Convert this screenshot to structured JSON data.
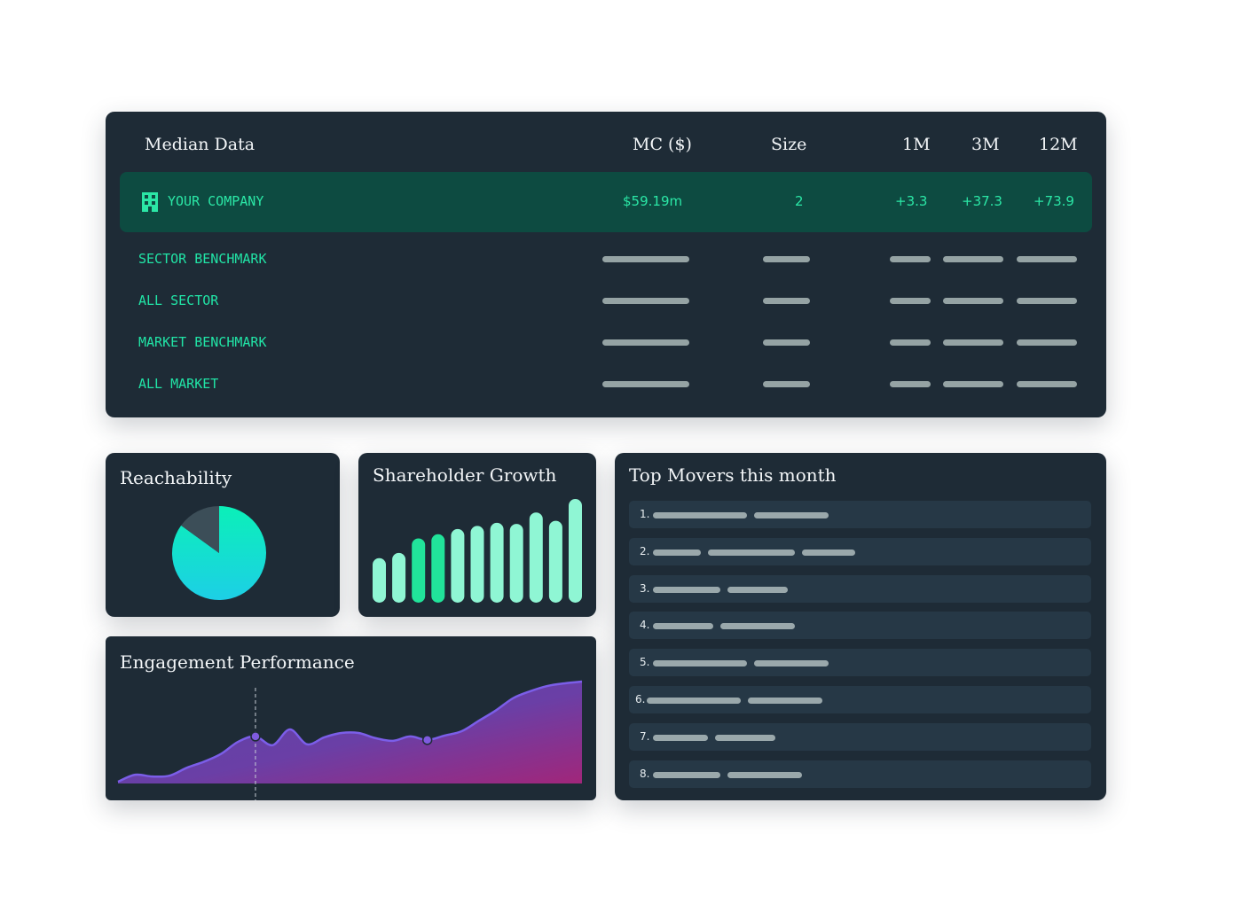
{
  "median": {
    "title": "Median Data",
    "columns": [
      "MC ($)",
      "Size",
      "1M",
      "3M",
      "12M"
    ],
    "company": {
      "icon": "building-icon",
      "name": "YOUR COMPANY",
      "mc": "$59.19m",
      "size": "2",
      "m1": "+3.3",
      "m3": "+37.3",
      "m12": "+73.9"
    },
    "rows": [
      "SECTOR BENCHMARK",
      "ALL SECTOR",
      "MARKET BENCHMARK",
      "ALL MARKET"
    ]
  },
  "reachability": {
    "title": "Reachability",
    "chart_data": {
      "type": "pie",
      "slices": [
        {
          "label": "",
          "value": 85,
          "color": "#19d9d6"
        },
        {
          "label": "",
          "value": 15,
          "color": "#3c4e58"
        }
      ]
    }
  },
  "shareholder": {
    "title": "Shareholder Growth",
    "chart_data": {
      "type": "bar",
      "values": [
        43,
        48,
        62,
        66,
        71,
        74,
        77,
        76,
        87,
        79,
        100
      ],
      "colors": [
        "#8ff6d4",
        "#8ff6d4",
        "#21e39a",
        "#21e39a",
        "#8ff6d4",
        "#8ff6d4",
        "#8ff6d4",
        "#8ff6d4",
        "#8ff6d4",
        "#8ff6d4",
        "#8ff6d4"
      ]
    }
  },
  "engagement": {
    "title": "Engagement Performance",
    "chart_data": {
      "type": "area",
      "values": [
        2,
        10,
        8,
        9,
        18,
        25,
        34,
        48,
        54,
        44,
        62,
        45,
        53,
        58,
        58,
        52,
        49,
        54,
        50,
        55,
        60,
        72,
        84,
        98,
        106,
        112,
        115,
        117
      ],
      "markers": [
        8,
        18
      ],
      "marker_color": "#7f5bdf",
      "line_color": "#7b5ee8"
    }
  },
  "movers": {
    "title": "Top Movers this month",
    "items": [
      {
        "num": "1.",
        "bars": [
          106,
          84
        ]
      },
      {
        "num": "2.",
        "bars": [
          54,
          98,
          60
        ]
      },
      {
        "num": "3.",
        "bars": [
          76,
          68
        ]
      },
      {
        "num": "4.",
        "bars": [
          68,
          84
        ]
      },
      {
        "num": "5.",
        "bars": [
          106,
          84
        ]
      },
      {
        "num": "6.",
        "bars": [
          106,
          84
        ]
      },
      {
        "num": "7.",
        "bars": [
          62,
          68
        ]
      },
      {
        "num": "8.",
        "bars": [
          76,
          84
        ]
      }
    ]
  }
}
